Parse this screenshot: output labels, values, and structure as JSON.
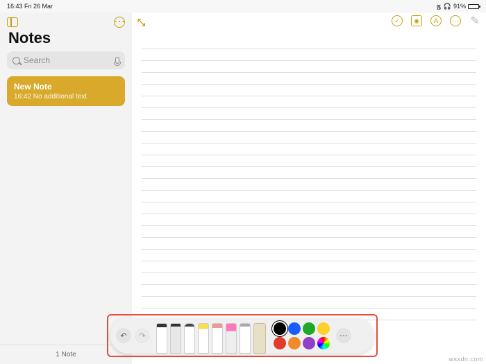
{
  "status": {
    "time": "16:43 Fri 26 Mar",
    "battery": "91%"
  },
  "sidebar": {
    "title": "Notes",
    "search_placeholder": "Search",
    "note": {
      "title": "New Note",
      "subtitle": "16:42  No additional text"
    },
    "footer": "1 Note"
  },
  "toolbar_icons": [
    "check-icon",
    "camera-icon",
    "pencil-circle-icon",
    "more-icon",
    "compose-icon"
  ],
  "palette": {
    "tools": [
      "pen",
      "pencil",
      "marker",
      "hl",
      "crayon",
      "eraser",
      "lasso",
      "ruler"
    ],
    "colors": [
      "#000000",
      "#1b5cff",
      "#1fa82a",
      "#ffcf2b",
      "#e13b2b",
      "#f08b2c",
      "#9040c7",
      "rainbow"
    ],
    "selected_color": 0
  },
  "watermark": "wsxdn.com"
}
